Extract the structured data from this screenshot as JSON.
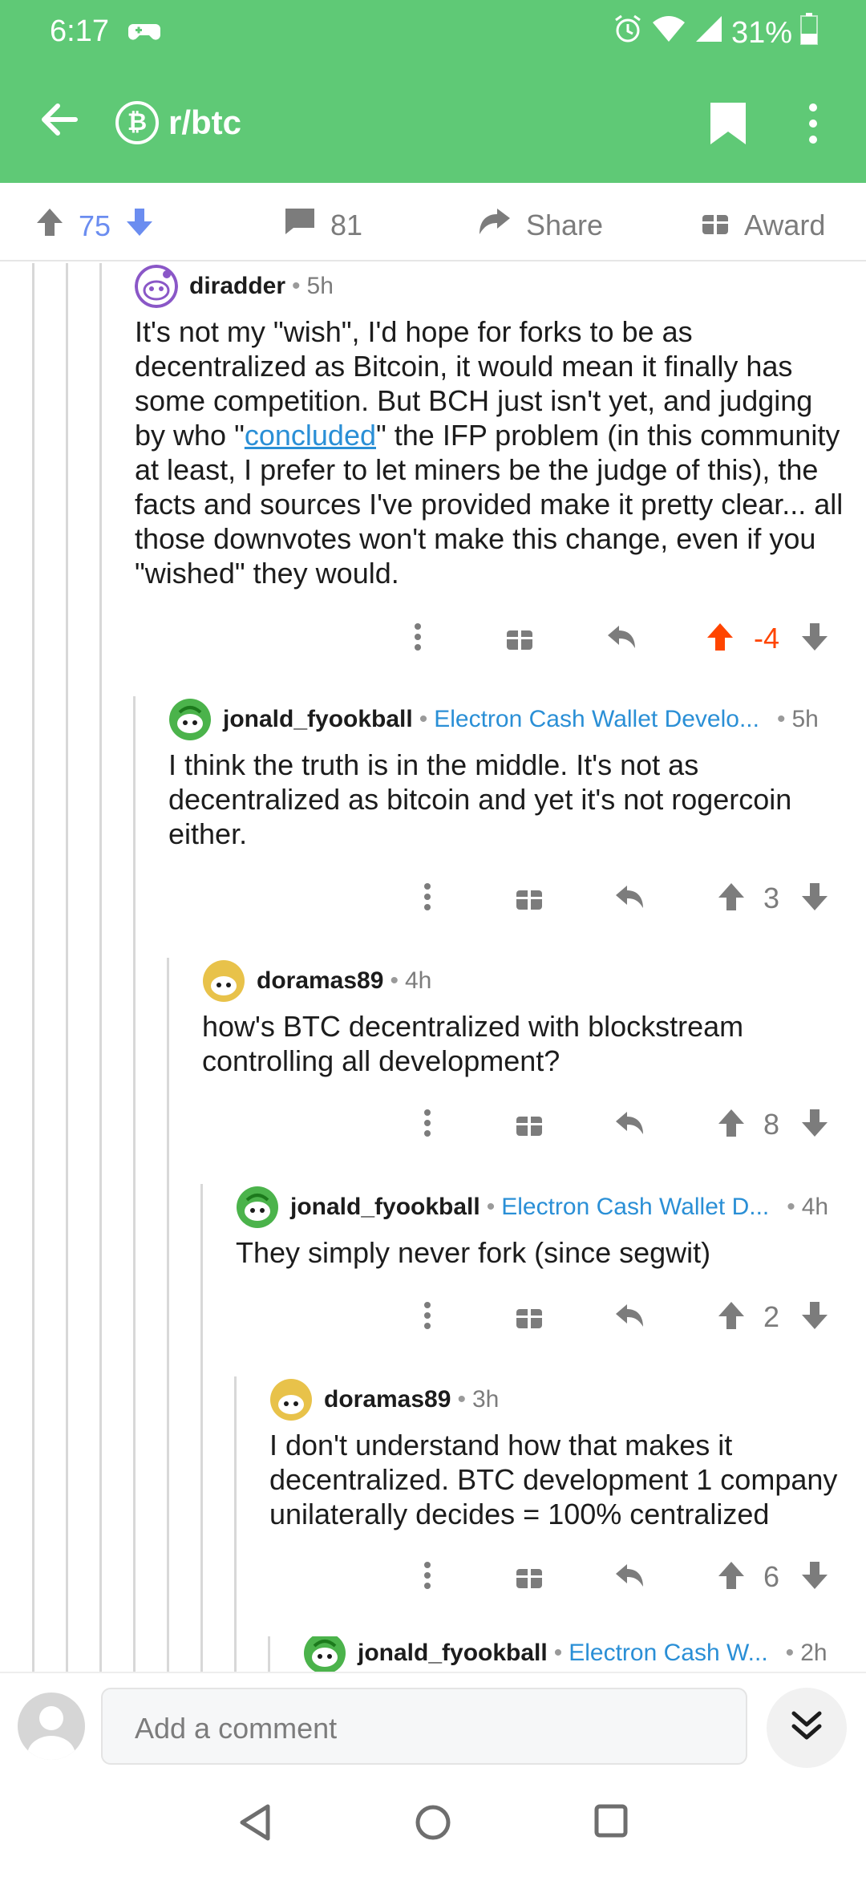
{
  "status": {
    "time": "6:17",
    "battery": "31%"
  },
  "appbar": {
    "subreddit": "r/btc",
    "sub_symbol": "₿"
  },
  "post_actions": {
    "score": "75",
    "comments": "81",
    "share": "Share",
    "award": "Award"
  },
  "comments": [
    {
      "user": "diradder",
      "flair": "",
      "time": "5h",
      "body_parts": [
        "It's not my \"wish\", I'd hope for forks to be as decentralized as Bitcoin, it would mean it finally has some competition. But BCH just isn't yet, and judging by who \"",
        "concluded",
        "\" the IFP problem (in this community at least, I prefer to let miners be the judge of this), the facts and sources I've provided make it pretty clear... all those downvotes won't make this change, even if you \"wished\" they would."
      ],
      "score": "-4"
    },
    {
      "user": "jonald_fyookball",
      "flair": "Electron Cash Wallet Develo...",
      "time": "5h",
      "body": "I think the truth is in the middle. It's not as decentralized as bitcoin and yet it's not rogercoin either.",
      "score": "3"
    },
    {
      "user": "doramas89",
      "flair": "",
      "time": "4h",
      "body": "how's BTC decentralized with blockstream controlling all development?",
      "score": "8"
    },
    {
      "user": "jonald_fyookball",
      "flair": "Electron Cash Wallet D...",
      "time": "4h",
      "body": "They simply never fork (since segwit)",
      "score": "2"
    },
    {
      "user": "doramas89",
      "flair": "",
      "time": "3h",
      "body": "I don't understand how that makes it decentralized. BTC development 1 company unilaterally decides = 100% centralized",
      "score": "6"
    },
    {
      "user": "jonald_fyookball",
      "flair": "Electron Cash W...",
      "time": "2h"
    }
  ],
  "input": {
    "placeholder": "Add a comment"
  },
  "colors": {
    "brand": "#5fc976",
    "upvoted": "#ff4500",
    "flair": "#2a8fd6",
    "score_blue": "#6b8df0"
  }
}
